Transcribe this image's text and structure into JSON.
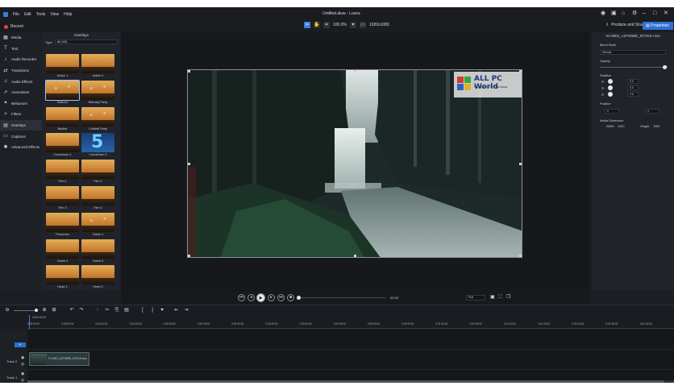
{
  "app": {
    "title": "Untitled.aluw - Luxea",
    "menu": [
      "File",
      "Edit",
      "Tools",
      "View",
      "Help"
    ],
    "recent_label": "Recent",
    "zoom": "100.0%",
    "resolution": "1920x1080",
    "produce_label": "Produce and Share",
    "properties_label": "Properties"
  },
  "sidebar": {
    "items": [
      {
        "label": "Media",
        "icon": "media-icon"
      },
      {
        "label": "Text",
        "icon": "text-icon"
      },
      {
        "label": "Audio Recorder",
        "icon": "mic-icon"
      },
      {
        "label": "Transitions",
        "icon": "transitions-icon"
      },
      {
        "label": "Audio Effects",
        "icon": "audio-effects-icon"
      },
      {
        "label": "Animations",
        "icon": "animations-icon"
      },
      {
        "label": "Behaviors",
        "icon": "behaviors-icon"
      },
      {
        "label": "Filters",
        "icon": "filters-icon"
      },
      {
        "label": "Overlays",
        "icon": "overlays-icon"
      },
      {
        "label": "Captions",
        "icon": "captions-icon"
      },
      {
        "label": "Advanced Effects",
        "icon": "advanced-effects-icon"
      }
    ]
  },
  "overlays": {
    "title": "Overlays",
    "type_label": "Type",
    "type_value": "All (40)",
    "items": [
      "Action 1",
      "Action 2",
      "Balloon",
      "Birthday Party",
      "Bubble",
      "Confetti Party",
      "Countdown 1",
      "Countdown 2",
      "Film 1",
      "Film 2",
      "Film 3",
      "Film 4",
      "Fireworks",
      "Game 1",
      "Game 2",
      "Game 3",
      "Heart 1",
      "Heart 2"
    ]
  },
  "watermark": {
    "title": "ALL PC World",
    "subtitle": "Free Apps One Click Away"
  },
  "properties": {
    "file": "V1-0001_A2TSSEE_STOCK.mov",
    "blend_mode_label": "Blend Mode",
    "blend_mode_value": "Normal",
    "opacity_label": "Opacity",
    "opacity_value": "1",
    "rotation_label": "Rotation",
    "rotation_values": [
      "0.0",
      "0.0",
      "0.0"
    ],
    "position_label": "Position",
    "position_x": "0",
    "position_y": "0",
    "media_dimension_label": "Media Dimension",
    "width_label": "Width",
    "width_value": "1920",
    "height_label": "Height",
    "height_value": "1080"
  },
  "transport": {
    "time": "00:00",
    "zoom_select": "Full"
  },
  "timeline": {
    "ruler": [
      "0:00:00:00",
      "0:00:05:00",
      "0:00:10:00",
      "0:00:15:00",
      "0:00:20:00",
      "0:00:25:00",
      "0:00:30:00",
      "0:00:35:00",
      "0:00:40:00",
      "0:00:45:00",
      "0:00:50:00",
      "0:00:55:00",
      "0:01:00:00",
      "0:01:05:00",
      "0:01:10:00",
      "0:01:15:00",
      "0:01:20:00",
      "0:01:25:00",
      "0:01:30:00"
    ],
    "playhead_time": "00:00:00:00",
    "tracks": [
      {
        "name": "Track 2",
        "clip": "V1-0001_A2TSSEE_STOCK.mov"
      },
      {
        "name": "Track 1",
        "clip": ""
      }
    ]
  }
}
